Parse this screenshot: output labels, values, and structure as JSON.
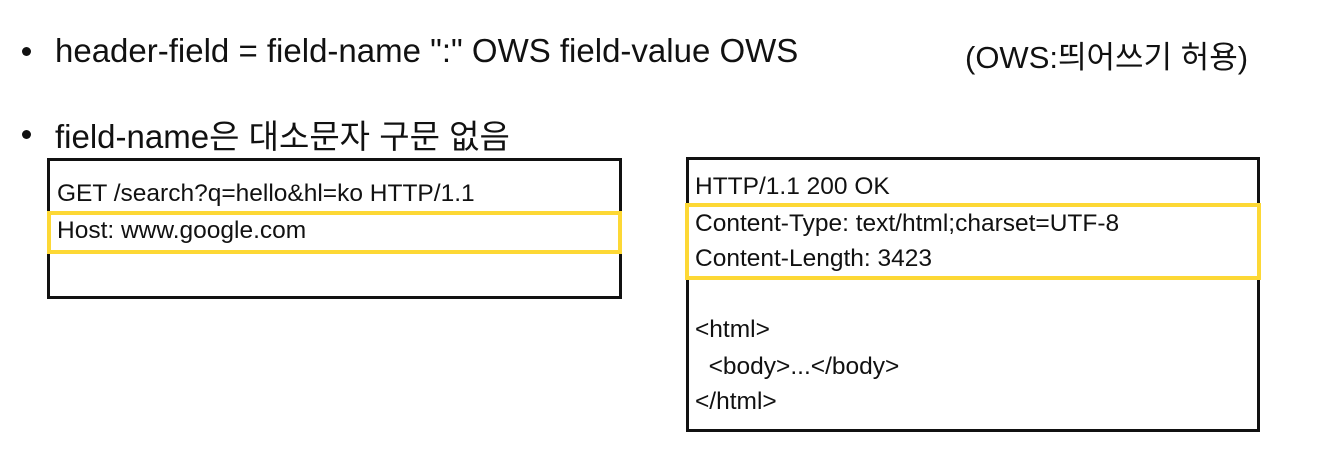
{
  "bullets": [
    {
      "text": "header-field = field-name \":\" OWS field-value OWS",
      "note": "(OWS:띄어쓰기 허용)"
    },
    {
      "text": "field-name은 대소문자 구문 없음"
    }
  ],
  "request": {
    "lines": [
      "GET /search?q=hello&hl=ko HTTP/1.1",
      "Host: www.google.com"
    ]
  },
  "response": {
    "lines": [
      "HTTP/1.1 200 OK",
      "Content-Type: text/html;charset=UTF-8",
      "Content-Length: 3423",
      "<html>",
      "  <body>...</body>",
      "</html>"
    ]
  },
  "colors": {
    "highlight": "#fdd835",
    "border": "#111111"
  }
}
